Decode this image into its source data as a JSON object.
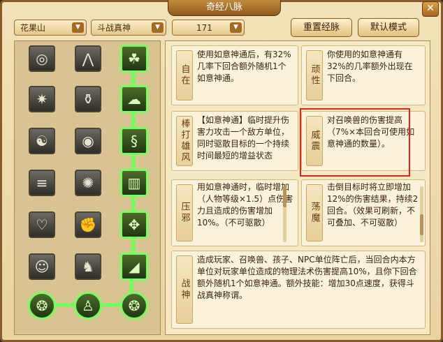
{
  "window": {
    "title": "奇经八脉",
    "close_label": "✕"
  },
  "toolbar": {
    "school": "花果山",
    "path": "斗战真神",
    "points": "171",
    "reset_label": "重置经脉",
    "default_label": "默认模式"
  },
  "tree": {
    "nodes": [
      {
        "icon": "swirl-icon",
        "glyph": "◎",
        "lit": false
      },
      {
        "icon": "claw-icon",
        "glyph": "⋀",
        "lit": false
      },
      {
        "icon": "rabbit-icon",
        "glyph": "☘",
        "lit": true
      },
      {
        "icon": "burst-icon",
        "glyph": "✷",
        "lit": false
      },
      {
        "icon": "pot-icon",
        "glyph": "⚱",
        "lit": false
      },
      {
        "icon": "cloud-icon",
        "glyph": "☁",
        "lit": true
      },
      {
        "icon": "mind-icon",
        "glyph": "☯",
        "lit": false
      },
      {
        "icon": "eye-icon",
        "glyph": "◉",
        "lit": false
      },
      {
        "icon": "spiral-icon",
        "glyph": "§",
        "lit": true
      },
      {
        "icon": "stack-icon",
        "glyph": "≡",
        "lit": false
      },
      {
        "icon": "vortex-icon",
        "glyph": "✺",
        "lit": false
      },
      {
        "icon": "pillar-icon",
        "glyph": "▥",
        "lit": true
      },
      {
        "icon": "heart-icon",
        "glyph": "♡",
        "lit": false
      },
      {
        "icon": "arm-icon",
        "glyph": "✊",
        "lit": false
      },
      {
        "icon": "beast-icon",
        "glyph": "✥",
        "lit": true
      },
      {
        "icon": "monkey-icon",
        "glyph": "☺",
        "lit": false
      },
      {
        "icon": "pig-icon",
        "glyph": "♞",
        "lit": false
      },
      {
        "icon": "curtain-icon",
        "glyph": "◢",
        "lit": true
      },
      {
        "icon": "coin-icon",
        "glyph": "❂",
        "lit": true
      },
      {
        "icon": "portrait-icon",
        "glyph": "♙",
        "lit": true
      },
      {
        "icon": "orb-icon",
        "glyph": "❂",
        "lit": true
      }
    ]
  },
  "skills": [
    {
      "name": "自在",
      "desc": "使用如意神通后，有32%几率下回合额外随机1个如意神通。"
    },
    {
      "name": "顽性",
      "desc": "你使用的如意神通有32%的几率额外出现在下回合。"
    },
    {
      "name": "棒打雄风",
      "desc": "【如意神通】临时提升伤害力攻击一个敌方单位，同时驱散目标的一个持续时间最短的增益状态"
    },
    {
      "name": "威震",
      "desc": "对召唤兽的伤害提高（7%×本回合可使用如意神通的数量）。"
    },
    {
      "name": "压邪",
      "desc": "用如意神通时，临时增加（人物等级×1.5）点伤害力且造成的伤害增加10%。（不可驱散）"
    },
    {
      "name": "荡魔",
      "desc": "击倒目标时将立即增加12%的伤害结果，持续2回合。（效果可刷新，不可叠加、不可驱散）"
    },
    {
      "name": "战神",
      "desc": "造成玩家、召唤兽、孩子、NPC单位阵亡后，当回合内本方单位对玩家单位造成的物理法术伤害提高10%，且你下回合额外随机1个如意神通。额外技能：增加30点速度，获得斗战真神称谓。"
    }
  ],
  "colors": {
    "highlight": "#e3241d",
    "glow": "#6dff5a"
  }
}
